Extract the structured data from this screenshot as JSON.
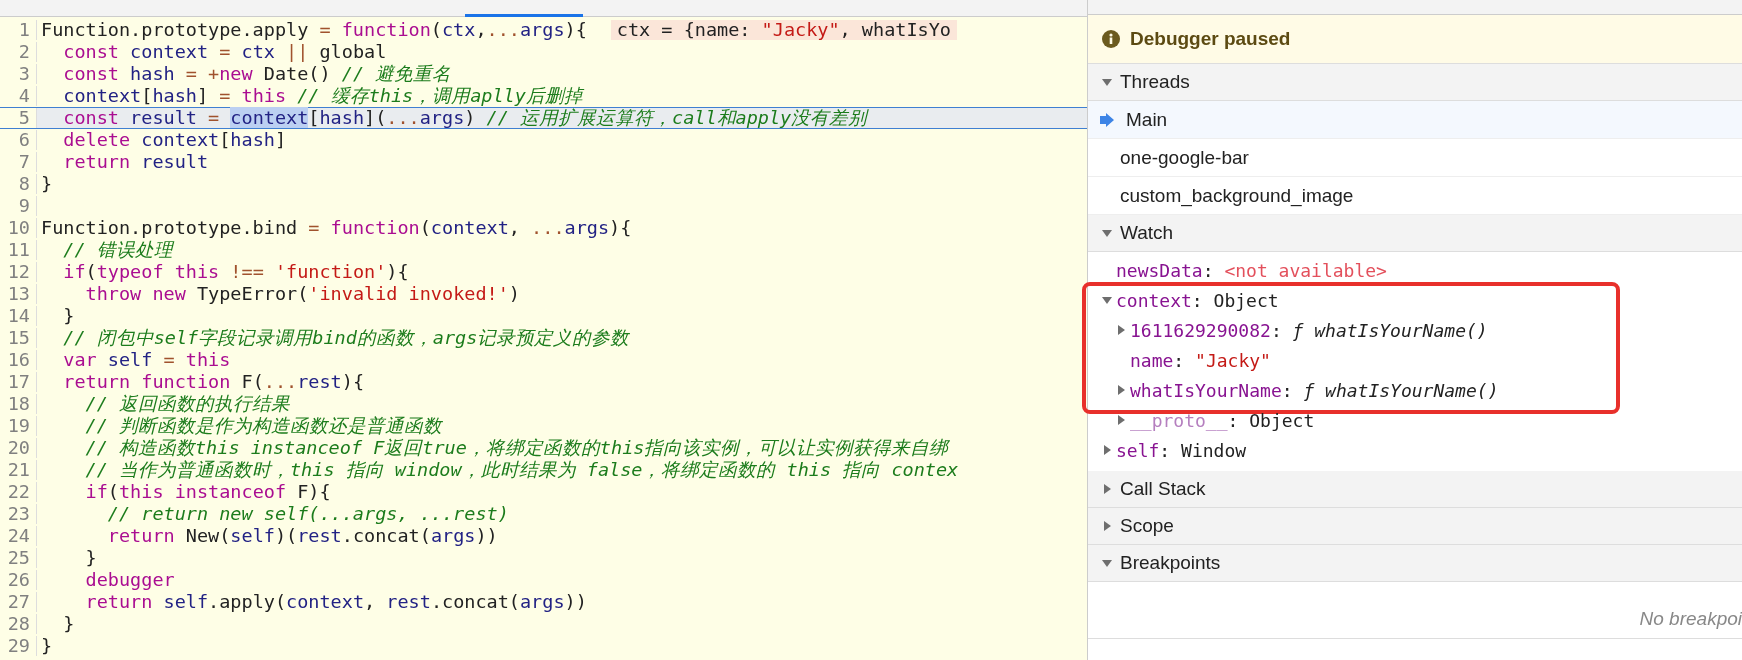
{
  "editor": {
    "lines": [
      {
        "number": "1",
        "current": false,
        "tokens": [
          {
            "kind": "p",
            "text": "Function.prototype.apply"
          },
          {
            "kind": "op",
            "text": " = "
          },
          {
            "kind": "kw",
            "text": "function"
          },
          {
            "kind": "p",
            "text": "("
          },
          {
            "kind": "var",
            "text": "ctx"
          },
          {
            "kind": "p",
            "text": ","
          },
          {
            "kind": "op",
            "text": "..."
          },
          {
            "kind": "var",
            "text": "args"
          },
          {
            "kind": "p",
            "text": "){"
          }
        ],
        "inline_value": [
          {
            "kind": "p",
            "text": "ctx = {name: "
          },
          {
            "kind": "str",
            "text": "\"Jacky\""
          },
          {
            "kind": "p",
            "text": ", whatIsYo"
          }
        ]
      },
      {
        "number": "2",
        "current": false,
        "tokens": [
          {
            "kind": "kw",
            "text": "  const"
          },
          {
            "kind": "var",
            "text": " context"
          },
          {
            "kind": "op",
            "text": " = "
          },
          {
            "kind": "var",
            "text": "ctx"
          },
          {
            "kind": "op",
            "text": " || "
          },
          {
            "kind": "p",
            "text": "global"
          }
        ]
      },
      {
        "number": "3",
        "current": false,
        "tokens": [
          {
            "kind": "kw",
            "text": "  const"
          },
          {
            "kind": "var",
            "text": " hash"
          },
          {
            "kind": "op",
            "text": " = +"
          },
          {
            "kind": "kw",
            "text": "new"
          },
          {
            "kind": "p",
            "text": " Date() "
          },
          {
            "kind": "cm",
            "text": "// 避免重名"
          }
        ]
      },
      {
        "number": "4",
        "current": false,
        "tokens": [
          {
            "kind": "var",
            "text": "  context"
          },
          {
            "kind": "p",
            "text": "["
          },
          {
            "kind": "var",
            "text": "hash"
          },
          {
            "kind": "p",
            "text": "] "
          },
          {
            "kind": "op",
            "text": "="
          },
          {
            "kind": "kw",
            "text": " this"
          },
          {
            "kind": "cm",
            "text": " // 缓存this，调用aplly后删掉"
          }
        ]
      },
      {
        "number": "5",
        "current": true,
        "tokens": [
          {
            "kind": "kw",
            "text": "  const"
          },
          {
            "kind": "var",
            "text": " result"
          },
          {
            "kind": "op",
            "text": " = "
          },
          {
            "kind": "sel",
            "text": "context"
          },
          {
            "kind": "p",
            "text": "["
          },
          {
            "kind": "var",
            "text": "hash"
          },
          {
            "kind": "p",
            "text": "]("
          },
          {
            "kind": "op",
            "text": "..."
          },
          {
            "kind": "var",
            "text": "args"
          },
          {
            "kind": "p",
            "text": ") "
          },
          {
            "kind": "cm",
            "text": "// 运用扩展运算符，call和apply没有差别"
          }
        ]
      },
      {
        "number": "6",
        "current": false,
        "tokens": [
          {
            "kind": "kw",
            "text": "  delete"
          },
          {
            "kind": "var",
            "text": " context"
          },
          {
            "kind": "p",
            "text": "["
          },
          {
            "kind": "var",
            "text": "hash"
          },
          {
            "kind": "p",
            "text": "]"
          }
        ]
      },
      {
        "number": "7",
        "current": false,
        "tokens": [
          {
            "kind": "kw",
            "text": "  return"
          },
          {
            "kind": "var",
            "text": " result"
          }
        ]
      },
      {
        "number": "8",
        "current": false,
        "tokens": [
          {
            "kind": "p",
            "text": "}"
          }
        ]
      },
      {
        "number": "9",
        "current": false
      },
      {
        "number": "10",
        "current": false,
        "tokens": [
          {
            "kind": "p",
            "text": "Function.prototype.bind"
          },
          {
            "kind": "op",
            "text": " = "
          },
          {
            "kind": "kw",
            "text": "function"
          },
          {
            "kind": "p",
            "text": "("
          },
          {
            "kind": "var",
            "text": "context"
          },
          {
            "kind": "p",
            "text": ", "
          },
          {
            "kind": "op",
            "text": "..."
          },
          {
            "kind": "var",
            "text": "args"
          },
          {
            "kind": "p",
            "text": "){"
          }
        ]
      },
      {
        "number": "11",
        "current": false,
        "tokens": [
          {
            "kind": "cm",
            "text": "  // 错误处理"
          }
        ]
      },
      {
        "number": "12",
        "current": false,
        "tokens": [
          {
            "kind": "kw",
            "text": "  if"
          },
          {
            "kind": "p",
            "text": "("
          },
          {
            "kind": "kw",
            "text": "typeof"
          },
          {
            "kind": "kw",
            "text": " this"
          },
          {
            "kind": "op",
            "text": " !== "
          },
          {
            "kind": "str",
            "text": "'function'"
          },
          {
            "kind": "p",
            "text": "){"
          }
        ]
      },
      {
        "number": "13",
        "current": false,
        "tokens": [
          {
            "kind": "kw",
            "text": "    throw"
          },
          {
            "kind": "kw",
            "text": " new"
          },
          {
            "kind": "p",
            "text": " TypeError("
          },
          {
            "kind": "str",
            "text": "'invalid invoked!'"
          },
          {
            "kind": "p",
            "text": ")"
          }
        ]
      },
      {
        "number": "14",
        "current": false,
        "tokens": [
          {
            "kind": "p",
            "text": "  }"
          }
        ]
      },
      {
        "number": "15",
        "current": false,
        "tokens": [
          {
            "kind": "cm",
            "text": "  // 闭包中self字段记录调用bind的函数，args记录预定义的参数"
          }
        ]
      },
      {
        "number": "16",
        "current": false,
        "tokens": [
          {
            "kind": "kw",
            "text": "  var"
          },
          {
            "kind": "var",
            "text": " self"
          },
          {
            "kind": "op",
            "text": " = "
          },
          {
            "kind": "kw",
            "text": "this"
          }
        ]
      },
      {
        "number": "17",
        "current": false,
        "tokens": [
          {
            "kind": "kw",
            "text": "  return"
          },
          {
            "kind": "kw",
            "text": " function"
          },
          {
            "kind": "p",
            "text": " F("
          },
          {
            "kind": "op",
            "text": "..."
          },
          {
            "kind": "var",
            "text": "rest"
          },
          {
            "kind": "p",
            "text": "){"
          }
        ]
      },
      {
        "number": "18",
        "current": false,
        "tokens": [
          {
            "kind": "cm",
            "text": "    // 返回函数的执行结果"
          }
        ]
      },
      {
        "number": "19",
        "current": false,
        "tokens": [
          {
            "kind": "cm",
            "text": "    // 判断函数是作为构造函数还是普通函数"
          }
        ]
      },
      {
        "number": "20",
        "current": false,
        "tokens": [
          {
            "kind": "cm",
            "text": "    // 构造函数this instanceof F返回true，将绑定函数的this指向该实例，可以让实例获得来自绑"
          }
        ]
      },
      {
        "number": "21",
        "current": false,
        "tokens": [
          {
            "kind": "cm",
            "text": "    // 当作为普通函数时，this 指向 window，此时结果为 false，将绑定函数的 this 指向 contex"
          }
        ]
      },
      {
        "number": "22",
        "current": false,
        "tokens": [
          {
            "kind": "kw",
            "text": "    if"
          },
          {
            "kind": "p",
            "text": "("
          },
          {
            "kind": "kw",
            "text": "this"
          },
          {
            "kind": "kw",
            "text": " instanceof"
          },
          {
            "kind": "p",
            "text": " F){"
          }
        ]
      },
      {
        "number": "23",
        "current": false,
        "tokens": [
          {
            "kind": "cm",
            "text": "      // return new self(...args, ...rest)"
          }
        ]
      },
      {
        "number": "24",
        "current": false,
        "tokens": [
          {
            "kind": "kw",
            "text": "      return"
          },
          {
            "kind": "p",
            "text": " New("
          },
          {
            "kind": "var",
            "text": "self"
          },
          {
            "kind": "p",
            "text": ")("
          },
          {
            "kind": "var",
            "text": "rest"
          },
          {
            "kind": "p",
            "text": ".concat("
          },
          {
            "kind": "var",
            "text": "args"
          },
          {
            "kind": "p",
            "text": "))"
          }
        ]
      },
      {
        "number": "25",
        "current": false,
        "tokens": [
          {
            "kind": "p",
            "text": "    }"
          }
        ]
      },
      {
        "number": "26",
        "current": false,
        "tokens": [
          {
            "kind": "kw",
            "text": "    debugger"
          }
        ]
      },
      {
        "number": "27",
        "current": false,
        "tokens": [
          {
            "kind": "kw",
            "text": "    return"
          },
          {
            "kind": "var",
            "text": " self"
          },
          {
            "kind": "p",
            "text": ".apply("
          },
          {
            "kind": "var",
            "text": "context"
          },
          {
            "kind": "p",
            "text": ", "
          },
          {
            "kind": "var",
            "text": "rest"
          },
          {
            "kind": "p",
            "text": ".concat("
          },
          {
            "kind": "var",
            "text": "args"
          },
          {
            "kind": "p",
            "text": "))"
          }
        ]
      },
      {
        "number": "28",
        "current": false,
        "tokens": [
          {
            "kind": "p",
            "text": "  }"
          }
        ]
      },
      {
        "number": "29",
        "current": false,
        "tokens": [
          {
            "kind": "p",
            "text": "}"
          }
        ]
      }
    ]
  },
  "sidebar": {
    "banner": "Debugger paused",
    "sections": [
      {
        "kind": "threads",
        "title": "Threads",
        "expanded": true,
        "items": [
          {
            "label": "Main",
            "selected": true
          },
          {
            "label": "one-google-bar",
            "selected": false
          },
          {
            "label": "custom_background_image",
            "selected": false
          }
        ]
      },
      {
        "kind": "watch",
        "title": "Watch",
        "expanded": true,
        "items": [
          {
            "name": "newsData",
            "separator": ":",
            "value": "<not available>",
            "kind": "unavailable",
            "expandable": false,
            "internal": false
          },
          {
            "name": "context",
            "separator": ":",
            "value": "Object",
            "kind": "object",
            "expandable": true,
            "expanded": true,
            "internal": false,
            "highlighted": true,
            "children": [
              {
                "name": "1611629290082",
                "separator": ":",
                "value": "ƒ whatIsYourName()",
                "kind": "function",
                "expandable": true,
                "expanded": false,
                "internal": false
              },
              {
                "name": "name",
                "separator": ":",
                "value": "\"Jacky\"",
                "kind": "string",
                "expandable": false,
                "internal": false
              },
              {
                "name": "whatIsYourName",
                "separator": ":",
                "value": "ƒ whatIsYourName()",
                "kind": "function",
                "expandable": true,
                "expanded": false,
                "internal": false
              },
              {
                "name": "__proto__",
                "separator": ":",
                "value": "Object",
                "kind": "object",
                "expandable": true,
                "expanded": false,
                "internal": true
              }
            ]
          },
          {
            "name": "self",
            "separator": ":",
            "value": "Window",
            "kind": "object",
            "expandable": true,
            "expanded": false,
            "internal": false
          }
        ]
      },
      {
        "kind": "plain",
        "title": "Call Stack",
        "expanded": false
      },
      {
        "kind": "plain",
        "title": "Scope",
        "expanded": false
      },
      {
        "kind": "message",
        "title": "Breakpoints",
        "expanded": true,
        "message": "No breakpoi"
      }
    ]
  }
}
